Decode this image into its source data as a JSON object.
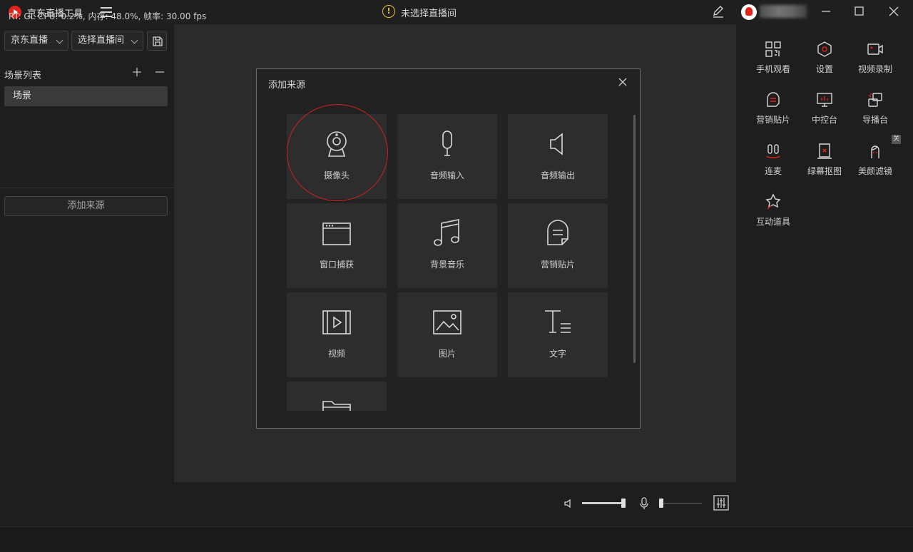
{
  "app": {
    "title": "京东直播工具",
    "room_status": "未选择直播间"
  },
  "left": {
    "platform_select": "京东直播",
    "room_select": "选择直播间",
    "scene_list_label": "场景列表",
    "scenes": [
      "场景"
    ],
    "add_source_label": "添加来源"
  },
  "dialog": {
    "title": "添加来源",
    "sources": [
      {
        "label": "摄像头",
        "icon": "camera-icon"
      },
      {
        "label": "音频输入",
        "icon": "microphone-icon"
      },
      {
        "label": "音频输出",
        "icon": "speaker-icon"
      },
      {
        "label": "窗口捕获",
        "icon": "window-icon"
      },
      {
        "label": "背景音乐",
        "icon": "music-note-icon"
      },
      {
        "label": "营销贴片",
        "icon": "sticker-icon"
      },
      {
        "label": "视频",
        "icon": "video-icon"
      },
      {
        "label": "图片",
        "icon": "image-icon"
      },
      {
        "label": "文字",
        "icon": "text-icon"
      },
      {
        "label": "",
        "icon": "folder-icon"
      }
    ]
  },
  "right": {
    "tools": [
      {
        "label": "手机观看",
        "icon": "qrcode-icon"
      },
      {
        "label": "设置",
        "icon": "settings-icon"
      },
      {
        "label": "视频录制",
        "icon": "video-record-icon"
      },
      {
        "label": "营销贴片",
        "icon": "sticker-icon"
      },
      {
        "label": "中控台",
        "icon": "monitor-icon"
      },
      {
        "label": "导播台",
        "icon": "switch-icon"
      },
      {
        "label": "连麦",
        "icon": "co-host-icon"
      },
      {
        "label": "绿幕抠图",
        "icon": "green-screen-icon"
      },
      {
        "label": "美颜滤镜",
        "icon": "beauty-icon"
      },
      {
        "label": "互动道具",
        "icon": "props-icon"
      }
    ],
    "beauty_badge": "关"
  },
  "status": {
    "text": "RT: GL CPU: 0.2%, 内存: 48.0%, 帧率: 30.00 fps"
  },
  "colors": {
    "accent": "#e1251b",
    "warning": "#e8c23a"
  }
}
